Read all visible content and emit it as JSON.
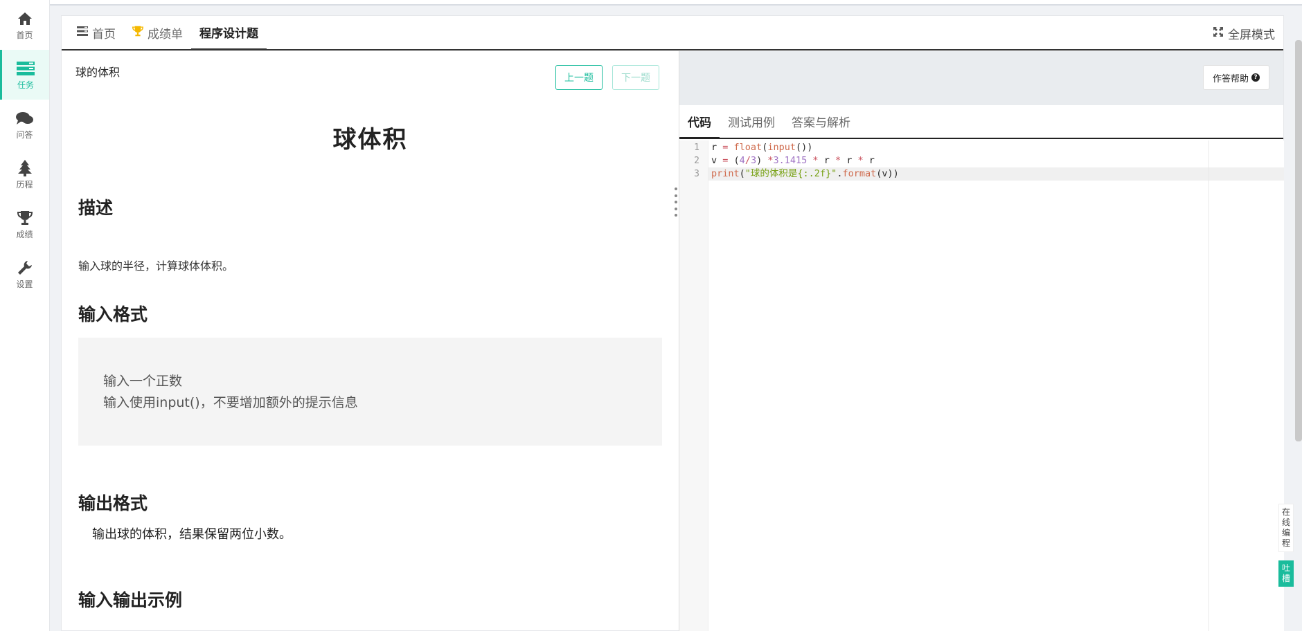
{
  "sidebar": {
    "items": [
      {
        "label": "首页",
        "icon": "home-icon",
        "active": false
      },
      {
        "label": "任务",
        "icon": "tasks-icon",
        "active": true
      },
      {
        "label": "问答",
        "icon": "chat-icon",
        "active": false
      },
      {
        "label": "历程",
        "icon": "tree-icon",
        "active": false
      },
      {
        "label": "成绩",
        "icon": "trophy-icon",
        "active": false
      },
      {
        "label": "设置",
        "icon": "wrench-icon",
        "active": false
      }
    ]
  },
  "tabs": {
    "home": "首页",
    "grades": "成绩单",
    "programming": "程序设计题",
    "fullscreen": "全屏模式"
  },
  "problem": {
    "small_title": "球的体积",
    "prev_label": "上一题",
    "next_label": "下一题",
    "big_title": "球体积",
    "desc_heading": "描述",
    "desc_text": "输入球的半径，计算球体体积。",
    "input_heading": "输入格式",
    "input_line1": "输入一个正数",
    "input_line2": "输入使用input()，不要增加额外的提示信息",
    "output_heading": "输出格式",
    "output_text": "输出球的体积，结果保留两位小数。",
    "example_heading": "输入输出示例"
  },
  "editor": {
    "help_label": "作答帮助",
    "tabs": [
      "代码",
      "测试用例",
      "答案与解析"
    ],
    "line_numbers": [
      "1",
      "2",
      "3"
    ]
  },
  "float_tabs": {
    "online": "在线编程",
    "roast": "吐槽"
  },
  "colors": {
    "accent": "#1abc9c"
  }
}
